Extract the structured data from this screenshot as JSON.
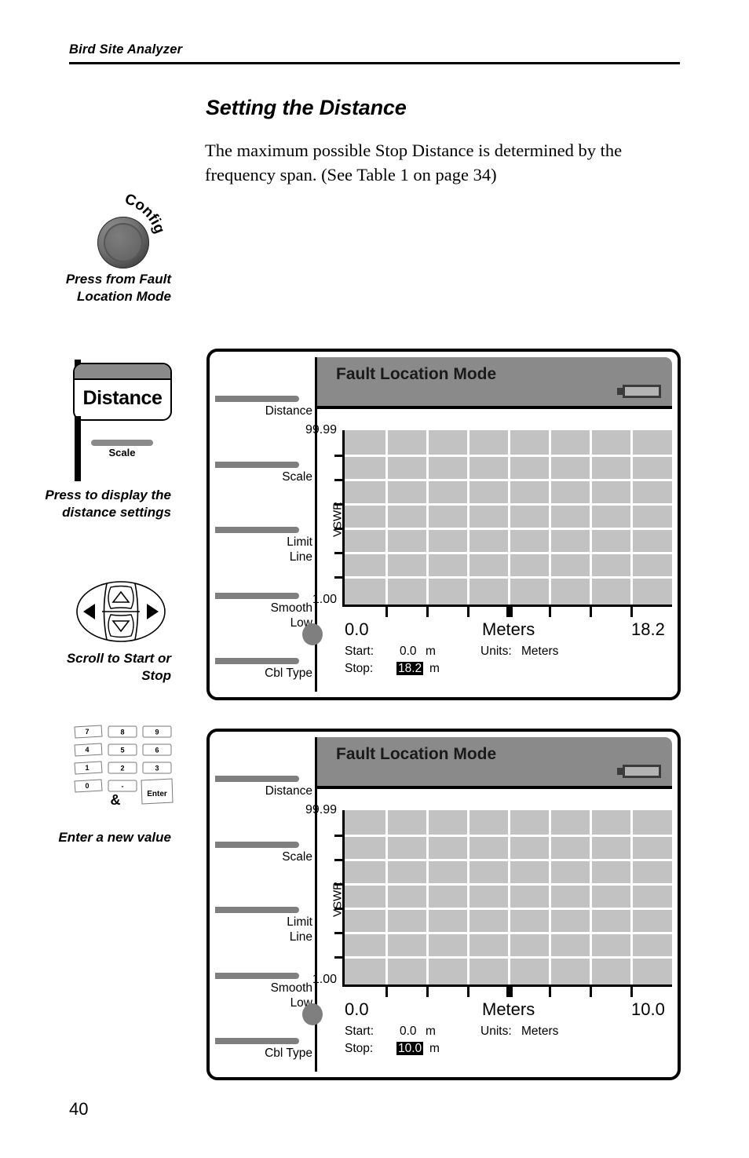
{
  "page": {
    "running_header": "Bird Site Analyzer",
    "number": "40"
  },
  "section": {
    "title": "Setting the Distance",
    "body": "The maximum possible Stop Distance is determined by the frequency span. (See Table 1 on page 34)"
  },
  "left_column": {
    "config_knob": {
      "icon": "rotary-knob-icon",
      "label": "Config",
      "caption": "Press from Fault Location Mode"
    },
    "distance_key": {
      "label": "Distance",
      "sub_label": "Scale",
      "caption": "Press to display the distance settings"
    },
    "dpad": {
      "icon": "dpad-icon",
      "caption": "Scroll to Start or Stop",
      "arrows": [
        "left",
        "up",
        "right",
        "down"
      ]
    },
    "keypad": {
      "caption": "Enter a new value",
      "ampersand": "&",
      "rows": [
        [
          "7",
          "8",
          "9"
        ],
        [
          "4",
          "5",
          "6"
        ],
        [
          "1",
          "2",
          "3"
        ],
        [
          "0",
          "-",
          "Enter"
        ]
      ]
    }
  },
  "panels": [
    {
      "title": "Fault Location Mode",
      "battery_icon": "battery-icon",
      "softkeys": [
        {
          "label": "Distance"
        },
        {
          "label": "Scale"
        },
        {
          "label": "Limit\nLine"
        },
        {
          "label": "Smooth\nLow"
        },
        {
          "label": "Cbl Type"
        }
      ],
      "softkey_labels": {
        "k0": "Distance",
        "k1": "Scale",
        "k2a": "Limit",
        "k2b": "Line",
        "k3a": "Smooth",
        "k3b": "Low",
        "k4": "Cbl Type"
      },
      "chart": {
        "y_max_label": "99.99",
        "y_min_label": "1.00",
        "y_axis_title": "VSWR",
        "x_min_label": "0.0",
        "x_axis_title": "Meters",
        "x_max_label": "18.2"
      },
      "readout": {
        "start_label": "Start:",
        "start_value": "0.0",
        "start_unit": "m",
        "stop_label": "Stop:",
        "stop_value": "18.2",
        "stop_unit": "m",
        "units_label": "Units:",
        "units_value": "Meters"
      }
    },
    {
      "title": "Fault Location Mode",
      "battery_icon": "battery-icon",
      "softkey_labels": {
        "k0": "Distance",
        "k1": "Scale",
        "k2a": "Limit",
        "k2b": "Line",
        "k3a": "Smooth",
        "k3b": "Low",
        "k4": "Cbl Type"
      },
      "chart": {
        "y_max_label": "99.99",
        "y_min_label": "1.00",
        "y_axis_title": "VSWR",
        "x_min_label": "0.0",
        "x_axis_title": "Meters",
        "x_max_label": "10.0"
      },
      "readout": {
        "start_label": "Start:",
        "start_value": "0.0",
        "start_unit": "m",
        "stop_label": "Stop:",
        "stop_value": "10.0",
        "stop_unit": "m",
        "units_label": "Units:",
        "units_value": "Meters"
      }
    }
  ],
  "chart_data": [
    {
      "type": "line",
      "title": "Fault Location Mode",
      "xlabel": "Meters",
      "ylabel": "VSWR",
      "xlim": [
        0.0,
        18.2
      ],
      "ylim": [
        1.0,
        99.99
      ],
      "x_tick_labels": [
        "0.0",
        "18.2"
      ],
      "y_tick_labels": [
        "1.00",
        "99.99"
      ],
      "grid": true,
      "grid_columns": 8,
      "grid_rows": 7,
      "series": [],
      "annotations": [
        "Start: 0.0 m",
        "Stop: 18.2 m",
        "Units: Meters"
      ]
    },
    {
      "type": "line",
      "title": "Fault Location Mode",
      "xlabel": "Meters",
      "ylabel": "VSWR",
      "xlim": [
        0.0,
        10.0
      ],
      "ylim": [
        1.0,
        99.99
      ],
      "x_tick_labels": [
        "0.0",
        "10.0"
      ],
      "y_tick_labels": [
        "1.00",
        "99.99"
      ],
      "grid": true,
      "grid_columns": 8,
      "grid_rows": 7,
      "series": [],
      "annotations": [
        "Start: 0.0 m",
        "Stop: 10.0 m",
        "Units: Meters"
      ]
    }
  ],
  "colors": {
    "ink": "#000000",
    "screen_gray": "#c2c2c2",
    "titlebar_gray": "#8a8a8a",
    "softkey_gray": "#7f7f7f",
    "grid_white": "#ffffff"
  }
}
